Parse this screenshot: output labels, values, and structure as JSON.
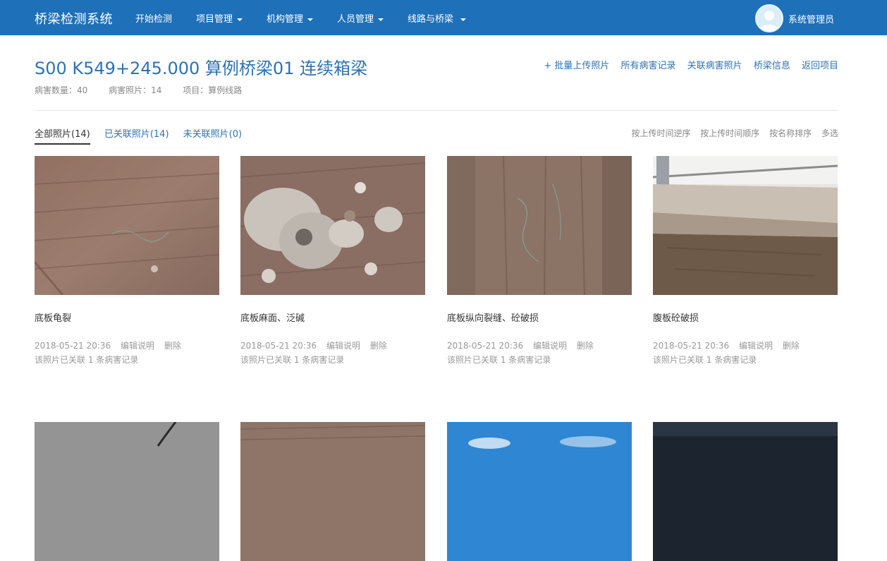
{
  "nav": {
    "brand": "桥梁检测系统",
    "items": [
      {
        "label": "开始检测",
        "caret": false
      },
      {
        "label": "项目管理",
        "caret": true
      },
      {
        "label": "机构管理",
        "caret": true
      },
      {
        "label": "人员管理",
        "caret": true
      },
      {
        "label": "线路与桥梁",
        "caret": true
      }
    ],
    "user": "系统管理员"
  },
  "header": {
    "title": "S00 K549+245.000 算例桥梁01 连续箱梁",
    "stats": [
      "病害数量：40",
      "病害照片：14",
      "项目：算例线路"
    ],
    "actions": [
      "+ 批量上传照片",
      "所有病害记录",
      "关联病害照片",
      "桥梁信息",
      "返回项目"
    ]
  },
  "tabs": [
    "全部照片(14)",
    "已关联照片(14)",
    "未关联照片(0)"
  ],
  "sort_options": [
    "按上传时间逆序",
    "按上传时间顺序",
    "按名称排序",
    "多选"
  ],
  "photos": [
    {
      "caption": "底板龟裂",
      "time": "2018-05-21 20:36",
      "edit": "编辑说明",
      "delete": "删除",
      "linked": "该照片已关联 1 条病害记录",
      "image": "concrete-crack-photo"
    },
    {
      "caption": "底板麻面、泛碱",
      "time": "2018-05-21 20:36",
      "edit": "编辑说明",
      "delete": "删除",
      "linked": "该照片已关联 1 条病害记录",
      "image": "efflorescence-photo"
    },
    {
      "caption": "底板纵向裂缝、砼破损",
      "time": "2018-05-21 20:36",
      "edit": "编辑说明",
      "delete": "删除",
      "linked": "该照片已关联 1 条病害记录",
      "image": "longitudinal-crack-photo"
    },
    {
      "caption": "腹板砼破损",
      "time": "2018-05-21 20:36",
      "edit": "编辑说明",
      "delete": "删除",
      "linked": "该照片已关联 1 条病害记录",
      "image": "web-damage-photo"
    },
    {
      "image": "asphalt-crack-photo"
    },
    {
      "image": "concrete-slab-photo"
    },
    {
      "image": "sky-photo"
    },
    {
      "image": "dark-sky-photo"
    }
  ]
}
